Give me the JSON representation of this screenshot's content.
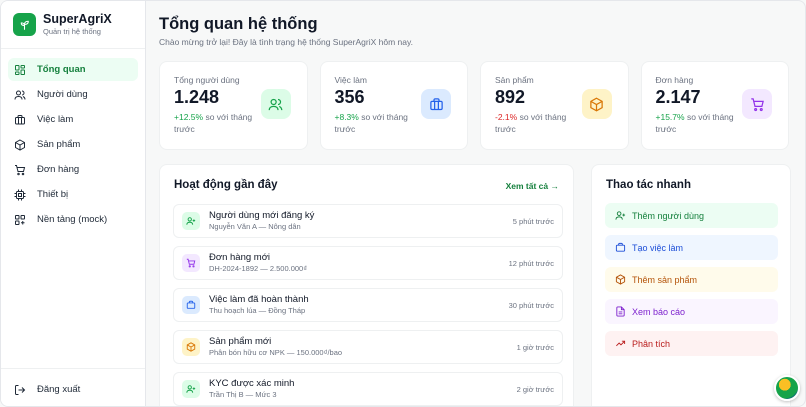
{
  "brand": {
    "name": "SuperAgriX",
    "subtitle": "Quản trị hệ thống",
    "icon": "sprout-icon",
    "accent": "#16a34a"
  },
  "sidebar": {
    "items": [
      {
        "label": "Tổng quan",
        "icon": "dashboard-icon",
        "active": true
      },
      {
        "label": "Người dùng",
        "icon": "users-icon"
      },
      {
        "label": "Việc làm",
        "icon": "briefcase-icon"
      },
      {
        "label": "Sản phẩm",
        "icon": "box-icon"
      },
      {
        "label": "Đơn hàng",
        "icon": "cart-icon"
      },
      {
        "label": "Thiết bị",
        "icon": "chip-icon"
      },
      {
        "label": "Nền tảng (mock)",
        "icon": "globe-icon"
      }
    ],
    "logout": {
      "label": "Đăng xuất",
      "icon": "logout-icon"
    }
  },
  "header": {
    "title": "Tổng quan hệ thống",
    "subtitle": "Chào mừng trở lại! Đây là tình trạng hệ thống SuperAgriX hôm nay."
  },
  "stats": [
    {
      "label": "Tổng người dùng",
      "value": "1.248",
      "delta": "+12.5%",
      "delta_note": "so với tháng trước",
      "trend": "up",
      "icon": "users-icon",
      "icon_bg": "#dcfce7",
      "icon_color": "#16a34a"
    },
    {
      "label": "Việc làm",
      "value": "356",
      "delta": "+8.3%",
      "delta_note": "so với tháng trước",
      "trend": "up",
      "icon": "briefcase-icon",
      "icon_bg": "#dbeafe",
      "icon_color": "#2563eb"
    },
    {
      "label": "Sản phẩm",
      "value": "892",
      "delta": "-2.1%",
      "delta_note": "so với tháng trước",
      "trend": "down",
      "icon": "box-icon",
      "icon_bg": "#fef3c7",
      "icon_color": "#d97706"
    },
    {
      "label": "Đơn hàng",
      "value": "2.147",
      "delta": "+15.7%",
      "delta_note": "so với tháng trước",
      "trend": "up",
      "icon": "cart-icon",
      "icon_bg": "#f3e8ff",
      "icon_color": "#9333ea"
    }
  ],
  "activity": {
    "title": "Hoạt động gần đây",
    "see_all": "Xem tất cả",
    "items": [
      {
        "title": "Người dùng mới đăng ký",
        "sub": "Nguyễn Văn A — Nông dân",
        "time": "5 phút trước",
        "icon": "user-plus-icon",
        "bg": "#dcfce7",
        "color": "#16a34a"
      },
      {
        "title": "Đơn hàng mới",
        "sub": "DH-2024-1892 — 2.500.000₫",
        "time": "12 phút trước",
        "icon": "cart-icon",
        "bg": "#f3e8ff",
        "color": "#9333ea"
      },
      {
        "title": "Việc làm đã hoàn thành",
        "sub": "Thu hoạch lúa — Đồng Tháp",
        "time": "30 phút trước",
        "icon": "briefcase-icon",
        "bg": "#dbeafe",
        "color": "#2563eb"
      },
      {
        "title": "Sản phẩm mới",
        "sub": "Phân bón hữu cơ NPK — 150.000₫/bao",
        "time": "1 giờ trước",
        "icon": "box-icon",
        "bg": "#fef3c7",
        "color": "#d97706"
      },
      {
        "title": "KYC được xác minh",
        "sub": "Trần Thị B — Mức 3",
        "time": "2 giờ trước",
        "icon": "user-plus-icon",
        "bg": "#dcfce7",
        "color": "#16a34a"
      }
    ]
  },
  "quick": {
    "title": "Thao tác nhanh",
    "items": [
      {
        "label": "Thêm người dùng",
        "icon": "user-plus-icon",
        "bg": "#ecfdf3",
        "color": "#15803d"
      },
      {
        "label": "Tạo việc làm",
        "icon": "briefcase-icon",
        "bg": "#eff6ff",
        "color": "#1d4ed8"
      },
      {
        "label": "Thêm sản phẩm",
        "icon": "box-icon",
        "bg": "#fffbeb",
        "color": "#b45309"
      },
      {
        "label": "Xem báo cáo",
        "icon": "file-icon",
        "bg": "#faf5ff",
        "color": "#7e22ce"
      },
      {
        "label": "Phân tích",
        "icon": "trend-icon",
        "bg": "#fef2f2",
        "color": "#b91c1c"
      }
    ]
  }
}
